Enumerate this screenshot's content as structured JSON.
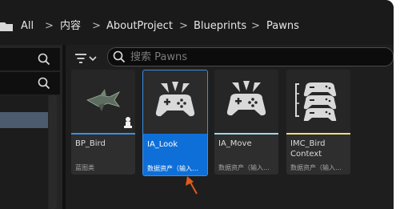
{
  "breadcrumb": {
    "items": [
      "All",
      "内容",
      "AboutProject",
      "Blueprints",
      "Pawns"
    ],
    "separator": ">"
  },
  "search": {
    "placeholder": "搜索 Pawns"
  },
  "assets": [
    {
      "name": "BP_Bird",
      "type": "蓝图类",
      "accent": "#3d8ee0",
      "selected": false
    },
    {
      "name": "IA_Look",
      "type": "数据资产（输入…",
      "accent": "#e05a1b",
      "selected": true
    },
    {
      "name": "IA_Move",
      "type": "数据资产（输入…",
      "accent": "#9fd7ea",
      "selected": false
    },
    {
      "name": "IMC_Bird Context",
      "type": "数据资产（输入…",
      "accent": "#eddc86",
      "selected": false
    }
  ],
  "colors": {
    "selection": "#0f6fd8",
    "annotation_arrow": "#e05a1b"
  },
  "icons": [
    "folder-icon",
    "chevron-right-icon",
    "search-icon",
    "filter-icon",
    "chevron-down-icon",
    "gamepad-icon",
    "pawn-icon",
    "red-arrow-icon"
  ]
}
